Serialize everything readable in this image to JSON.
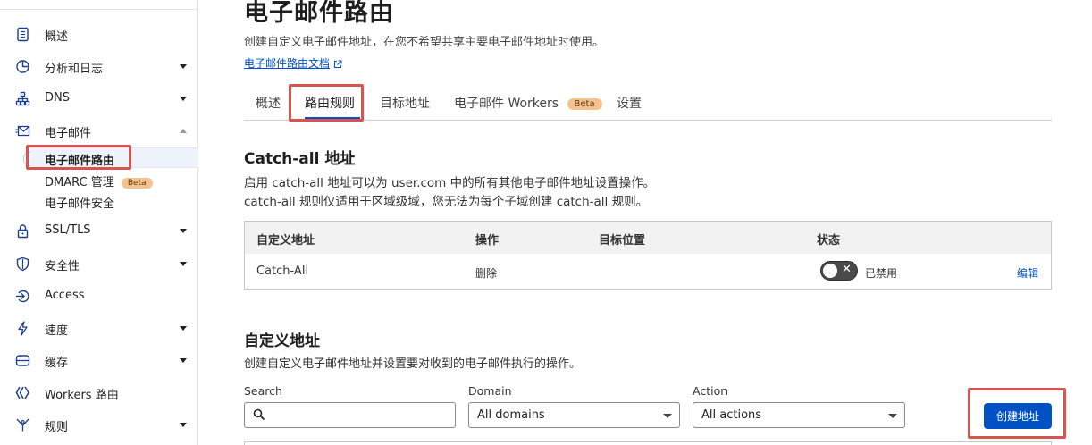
{
  "sidebar": {
    "items": [
      {
        "label": "概述",
        "icon": "document-icon"
      },
      {
        "label": "分析和日志",
        "icon": "chart-icon"
      },
      {
        "label": "DNS",
        "icon": "network-icon"
      },
      {
        "label": "电子邮件",
        "icon": "email-icon"
      },
      {
        "label": "SSL/TLS",
        "icon": "lock-icon"
      },
      {
        "label": "安全性",
        "icon": "shield-icon"
      },
      {
        "label": "Access",
        "icon": "access-icon"
      },
      {
        "label": "速度",
        "icon": "bolt-icon"
      },
      {
        "label": "缓存",
        "icon": "storage-icon"
      },
      {
        "label": "Workers 路由",
        "icon": "workers-icon"
      },
      {
        "label": "规则",
        "icon": "rules-icon"
      }
    ],
    "email_sub": {
      "routing": "电子邮件路由",
      "dmarc": "DMARC 管理",
      "dmarc_badge": "Beta",
      "security": "电子邮件安全"
    }
  },
  "page": {
    "title": "电子邮件路由",
    "description": "创建自定义电子邮件地址，在您不希望共享主要电子邮件地址时使用。",
    "doc_link": "电子邮件路由文档"
  },
  "tabs": [
    {
      "label": "概述"
    },
    {
      "label": "路由规则"
    },
    {
      "label": "目标地址"
    },
    {
      "label": "电子邮件 Workers",
      "badge": "Beta"
    },
    {
      "label": "设置"
    }
  ],
  "catch_all": {
    "title": "Catch-all 地址",
    "line1": "启用 catch-all 地址可以为 user.com 中的所有其他电子邮件地址设置操作。",
    "line2": "catch-all 规则仅适用于区域级域，您无法为每个子域创建 catch-all 规则。",
    "columns": [
      "自定义地址",
      "操作",
      "目标位置",
      "状态"
    ],
    "row": {
      "address": "Catch-All",
      "action": "删除",
      "destination": "",
      "status": "已禁用",
      "toggle_symbol": "✕",
      "edit": "编辑"
    }
  },
  "custom": {
    "title": "自定义地址",
    "description": "创建自定义电子邮件地址并设置要对收到的电子邮件执行的操作。",
    "search_label": "Search",
    "search_value": "",
    "domain_label": "Domain",
    "domain_value": "All domains",
    "action_label": "Action",
    "action_value": "All actions",
    "create_button": "创建地址"
  },
  "colors": {
    "accent": "#0051c3",
    "highlight_box": "#d9534f",
    "badge": "#f6c28c"
  }
}
